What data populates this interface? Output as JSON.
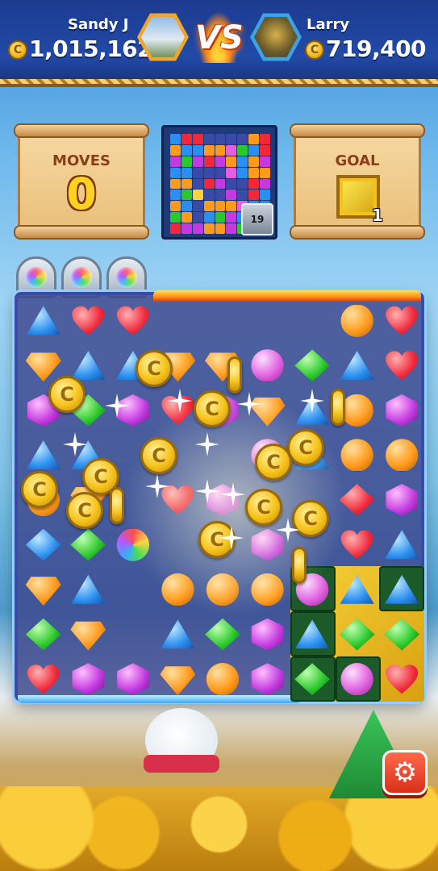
{
  "players": {
    "left": {
      "name": "Sandy J",
      "score": "1,015,162"
    },
    "right": {
      "name": "Larry",
      "score": "719,400"
    },
    "vs_label": "VS"
  },
  "coin_symbol": "C",
  "moves": {
    "label": "MOVES",
    "value": "0"
  },
  "goal": {
    "label": "GOAL",
    "count": "1",
    "tile_color": "#f7d33a"
  },
  "minimap": {
    "badge": "19"
  },
  "settings": {
    "icon": "gear-icon",
    "glyph": "⚙"
  },
  "board": {
    "rows": [
      [
        [
          "tri",
          "blue"
        ],
        [
          "heart",
          "red"
        ],
        [
          "heart",
          "red"
        ],
        [
          "",
          ""
        ],
        [
          "",
          ""
        ],
        [
          "",
          ""
        ],
        [
          "",
          ""
        ],
        [
          "orb",
          "orange"
        ],
        [
          "heart",
          "red"
        ]
      ],
      [
        [
          "cut",
          "orange"
        ],
        [
          "tri",
          "blue"
        ],
        [
          "tri",
          "blue"
        ],
        [
          "cut",
          "orange"
        ],
        [
          "cut",
          "orange"
        ],
        [
          "orb",
          "pink"
        ],
        [
          "diamond",
          "green"
        ],
        [
          "tri",
          "blue"
        ],
        [
          "heart",
          "red"
        ]
      ],
      [
        [
          "hex",
          "purple"
        ],
        [
          "diamond",
          "green"
        ],
        [
          "hex",
          "purple"
        ],
        [
          "heart",
          "red"
        ],
        [
          "hex",
          "purple"
        ],
        [
          "cut",
          "orange"
        ],
        [
          "tri",
          "blue"
        ],
        [
          "orb",
          "orange"
        ],
        [
          "hex",
          "purple"
        ]
      ],
      [
        [
          "tri",
          "blue"
        ],
        [
          "tri",
          "blue"
        ],
        [
          "",
          ""
        ],
        [
          "",
          ""
        ],
        [
          "",
          ""
        ],
        [
          "orb",
          "pink"
        ],
        [
          "tri",
          "blue"
        ],
        [
          "orb",
          "orange"
        ],
        [
          "orb",
          "orange"
        ]
      ],
      [
        [
          "orb",
          "orange"
        ],
        [
          "cut",
          "orange"
        ],
        [
          "",
          ""
        ],
        [
          "heart",
          "red"
        ],
        [
          "hex",
          "purple"
        ],
        [
          "",
          ""
        ],
        [
          "",
          ""
        ],
        [
          "diamond",
          "red"
        ],
        [
          "hex",
          "purple"
        ]
      ],
      [
        [
          "diamond",
          "blue"
        ],
        [
          "diamond",
          "green"
        ],
        [
          "orb",
          "rainbow"
        ],
        [
          "",
          ""
        ],
        [
          "",
          ""
        ],
        [
          "hex",
          "purple"
        ],
        [
          "",
          ""
        ],
        [
          "heart",
          "red"
        ],
        [
          "tri",
          "blue"
        ]
      ],
      [
        [
          "cut",
          "orange"
        ],
        [
          "tri",
          "blue"
        ],
        [
          "",
          ""
        ],
        [
          "orb",
          "orange"
        ],
        [
          "orb",
          "orange"
        ],
        [
          "orb",
          "orange"
        ],
        [
          "orb",
          "pink"
        ],
        [
          "tri",
          "blue"
        ],
        [
          "tri",
          "blue"
        ]
      ],
      [
        [
          "diamond",
          "green"
        ],
        [
          "cut",
          "orange"
        ],
        [
          "",
          ""
        ],
        [
          "tri",
          "blue"
        ],
        [
          "diamond",
          "green"
        ],
        [
          "hex",
          "purple"
        ],
        [
          "tri",
          "blue"
        ],
        [
          "diamond",
          "green"
        ],
        [
          "diamond",
          "green"
        ]
      ],
      [
        [
          "heart",
          "red"
        ],
        [
          "hex",
          "purple"
        ],
        [
          "hex",
          "purple"
        ],
        [
          "cut",
          "orange"
        ],
        [
          "orb",
          "orange"
        ],
        [
          "hex",
          "purple"
        ],
        [
          "diamond",
          "green"
        ],
        [
          "orb",
          "pink"
        ],
        [
          "heart",
          "red"
        ]
      ]
    ]
  }
}
